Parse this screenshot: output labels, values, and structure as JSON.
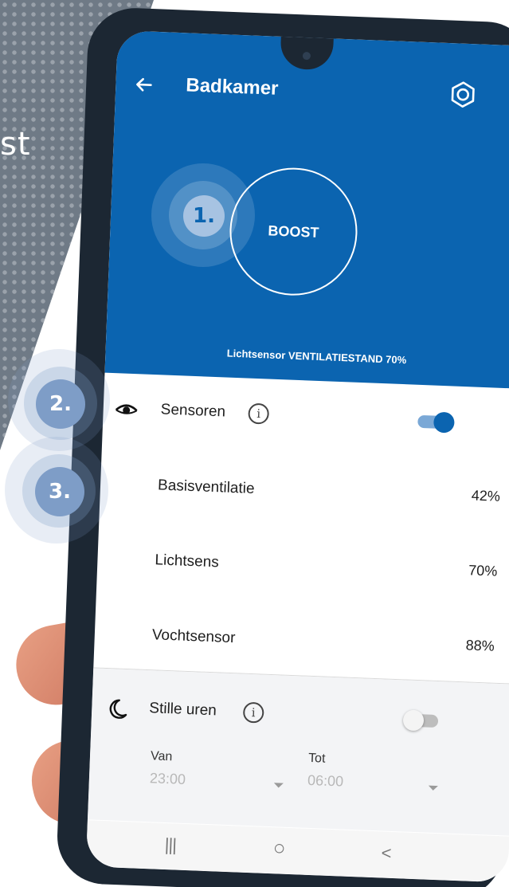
{
  "background": {
    "text": "st"
  },
  "header": {
    "title": "Badkamer",
    "boost_label": "BOOST",
    "status": "Lichtsensor VENTILATIESTAND 70%"
  },
  "steps": [
    {
      "label": "1."
    },
    {
      "label": "2."
    },
    {
      "label": "3."
    }
  ],
  "sensors": {
    "label": "Sensoren",
    "info_glyph": "i",
    "enabled": true,
    "items": [
      {
        "label": "Basisventilatie",
        "value": "42%"
      },
      {
        "label": "Lichtsens",
        "value": "70%"
      },
      {
        "label": "Vochtsensor",
        "value": "88%"
      }
    ]
  },
  "quiet_hours": {
    "label": "Stille uren",
    "info_glyph": "i",
    "enabled": false,
    "from_label": "Van",
    "from_value": "23:00",
    "to_label": "Tot",
    "to_value": "06:00"
  },
  "navbar": {
    "recent": "|||",
    "home": "○",
    "back": "<"
  },
  "colors": {
    "primary": "#0b64b0",
    "badge": "#7e9dc7",
    "background_panel": "#6f7a86"
  },
  "icons": [
    "back-arrow-icon",
    "gear-icon",
    "eye-icon",
    "info-icon",
    "moon-icon",
    "dropdown-caret-icon"
  ]
}
